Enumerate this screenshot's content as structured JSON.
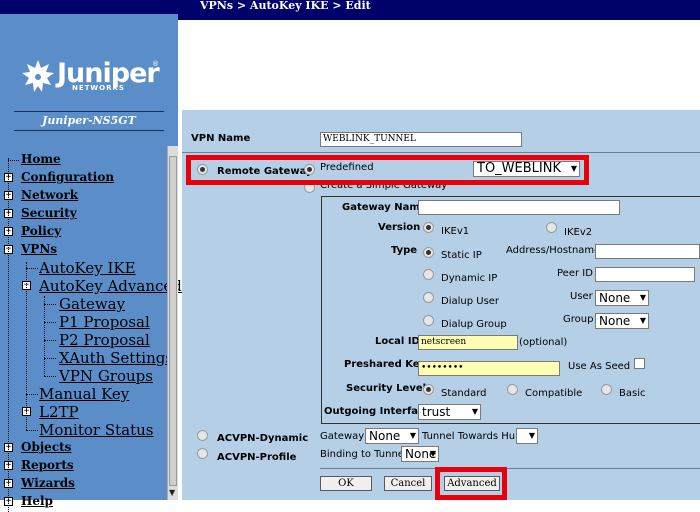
{
  "breadcrumb": "VPNs > AutoKey IKE > Edit",
  "logo": {
    "brand": "Juniper",
    "sub": "NETWORKS",
    "reg": "®"
  },
  "device_name": "Juniper-NS5GT",
  "nav": [
    {
      "label": "Home",
      "expander": "",
      "level": 0
    },
    {
      "label": "Configuration",
      "expander": "+",
      "level": 0
    },
    {
      "label": "Network",
      "expander": "+",
      "level": 0
    },
    {
      "label": "Security",
      "expander": "+",
      "level": 0
    },
    {
      "label": "Policy",
      "expander": "+",
      "level": 0
    },
    {
      "label": "VPNs",
      "expander": "−",
      "level": 0
    },
    {
      "label": "AutoKey IKE",
      "expander": "",
      "level": 1
    },
    {
      "label": "AutoKey Advanced",
      "expander": "−",
      "level": 1
    },
    {
      "label": "Gateway",
      "expander": "",
      "level": 2
    },
    {
      "label": "P1 Proposal",
      "expander": "",
      "level": 2
    },
    {
      "label": "P2 Proposal",
      "expander": "",
      "level": 2
    },
    {
      "label": "XAuth Settings",
      "expander": "",
      "level": 2
    },
    {
      "label": "VPN Groups",
      "expander": "",
      "level": 2
    },
    {
      "label": "Manual Key",
      "expander": "",
      "level": 1
    },
    {
      "label": "L2TP",
      "expander": "+",
      "level": 1
    },
    {
      "label": "Monitor Status",
      "expander": "",
      "level": 1
    },
    {
      "label": "Objects",
      "expander": "+",
      "level": 0
    },
    {
      "label": "Reports",
      "expander": "+",
      "level": 0
    },
    {
      "label": "Wizards",
      "expander": "+",
      "level": 0
    },
    {
      "label": "Help",
      "expander": "+",
      "level": 0
    }
  ],
  "form": {
    "vpn_name_label": "VPN Name",
    "vpn_name_value": "WEBLINK_TUNNEL",
    "remote_gateway_label": "Remote Gateway",
    "predefined_label": "Predefined",
    "predefined_value": "TO_WEBLINK",
    "create_simple_label": "Create a Simple Gateway",
    "gateway_name_label": "Gateway Name",
    "gateway_name_value": "",
    "version_label": "Version",
    "ikev1_label": "IKEv1",
    "ikev2_label": "IKEv2",
    "type_label": "Type",
    "static_ip_label": "Static IP",
    "address_label": "Address/Hostname",
    "address_value": "",
    "dynamic_ip_label": "Dynamic IP",
    "peer_id_label": "Peer ID",
    "peer_id_value": "",
    "dialup_user_label": "Dialup User",
    "user_label": "User",
    "user_value": "None",
    "dialup_group_label": "Dialup Group",
    "group_label": "Group",
    "group_value": "None",
    "local_id_label": "Local ID",
    "local_id_value": "netscreen",
    "local_id_hint": "(optional)",
    "preshared_label": "Preshared Key",
    "preshared_value": "••••••••",
    "use_as_seed_label": "Use As Seed",
    "security_level_label": "Security Level",
    "standard_label": "Standard",
    "compatible_label": "Compatible",
    "basic_label": "Basic",
    "outgoing_label": "Outgoing Interface",
    "outgoing_value": "trust",
    "acvpn_dynamic_label": "ACVPN-Dynamic",
    "gateway_label": "Gateway",
    "gateway_value": "None",
    "tunnel_hub_label": "Tunnel Towards Hub",
    "acvpn_profile_label": "ACVPN-Profile",
    "binding_label": "Binding to Tunnel",
    "binding_value": "None"
  },
  "buttons": {
    "ok": "OK",
    "cancel": "Cancel",
    "advanced": "Advanced"
  },
  "colors": {
    "header": "#00006b",
    "sidebar": "#5b8ec8",
    "form_bg": "#b4cfe6",
    "highlight": "#e8000b"
  }
}
